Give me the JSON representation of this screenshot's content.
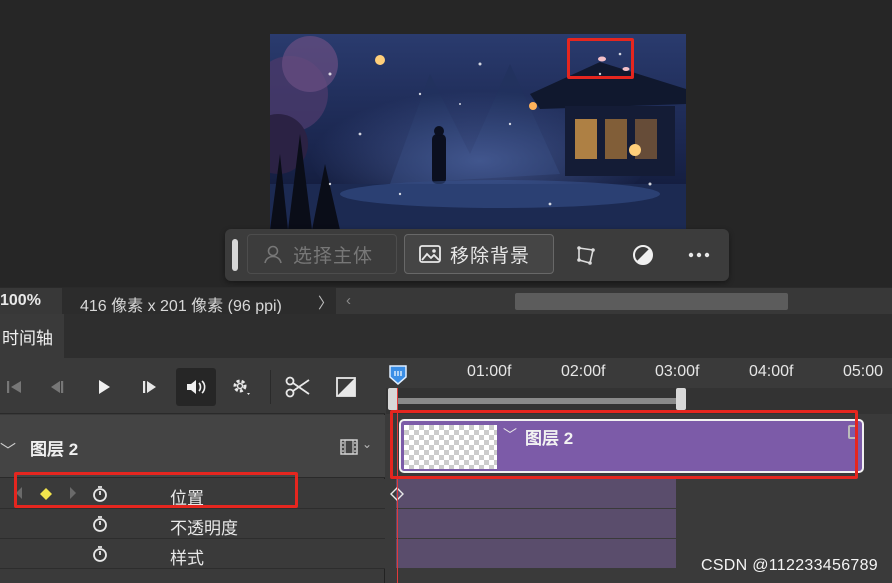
{
  "contextual_bar": {
    "select_subject_label": "选择主体",
    "remove_background_label": "移除背景",
    "icons": [
      "user-silhouette-icon",
      "image-icon",
      "transform-icon",
      "adjust-icon",
      "more-icon"
    ]
  },
  "status_bar": {
    "zoom": "100%",
    "document_info": "416 像素 x 201 像素 (96 ppi)",
    "info_arrow": "〉",
    "scroll_left": "‹"
  },
  "timeline": {
    "tab_label": "时间轴",
    "ruler_labels": [
      "01:00f",
      "02:00f",
      "03:00f",
      "04:00f",
      "05:00"
    ],
    "layer": {
      "name": "图层 2",
      "chevron": "﹀"
    },
    "properties": [
      "位置",
      "不透明度",
      "样式"
    ],
    "clip": {
      "name": "图层 2",
      "chevron": "﹀"
    }
  },
  "watermark": "CSDN @112233456789",
  "colors": {
    "annotation": "#e5261f",
    "clip": "#7c5ba8",
    "keyframe": "#f2e44d",
    "playhead": "#3a8ee6"
  }
}
